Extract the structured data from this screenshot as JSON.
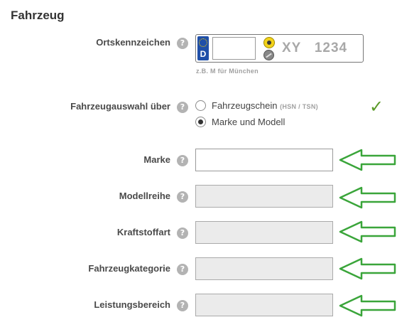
{
  "section": {
    "title": "Fahrzeug"
  },
  "help_glyph": "?",
  "license_plate": {
    "label": "Ortskennzeichen",
    "country": "D",
    "value": "",
    "placeholder_text": "XY   1234",
    "hint": "z.B. M für München"
  },
  "vehicle_selection": {
    "label": "Fahrzeugauswahl über",
    "options": [
      {
        "label": "Fahrzeugschein",
        "suffix": "(HSN / TSN)",
        "selected": false
      },
      {
        "label": "Marke und Modell",
        "selected": true
      }
    ],
    "valid_mark": "✓"
  },
  "fields": [
    {
      "label": "Marke",
      "value": "",
      "enabled": true
    },
    {
      "label": "Modellreihe",
      "value": "",
      "enabled": false
    },
    {
      "label": "Kraftstoffart",
      "value": "",
      "enabled": false
    },
    {
      "label": "Fahrzeugkategorie",
      "value": "",
      "enabled": false
    },
    {
      "label": "Leistungsbereich",
      "value": "",
      "enabled": false
    }
  ],
  "colors": {
    "accent_green": "#5a9a28",
    "arrow_green": "#3aa53a",
    "eu_blue": "#1f4fa8",
    "disabled_field": "#ebebeb"
  }
}
